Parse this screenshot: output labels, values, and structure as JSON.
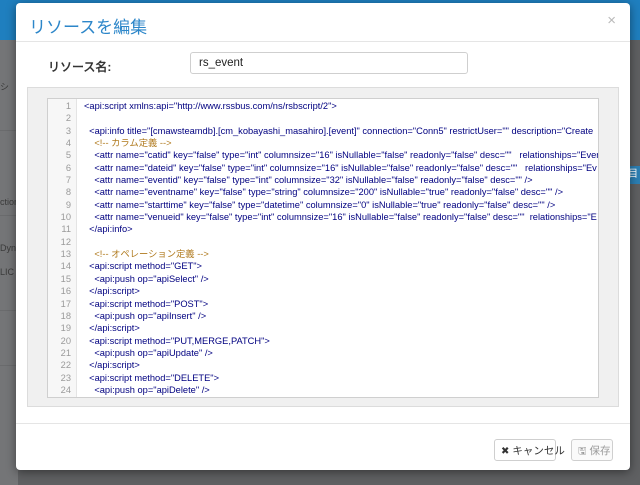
{
  "background": {
    "side_texts": [
      "シ",
      "ction",
      "Dyna",
      "LIC",
      "ル"
    ],
    "right_button": "目"
  },
  "modal": {
    "title": "リソースを編集",
    "close_icon": "×",
    "resource_name_label": "リソース名:",
    "resource_name_value": "rs_event"
  },
  "editor": {
    "lines": [
      {
        "n": "1",
        "text": "<api:script xmlns:api=\"http://www.rssbus.com/ns/rsbscript/2\">"
      },
      {
        "n": "2",
        "text": ""
      },
      {
        "n": "3",
        "text": "  <api:info title=\"[cmawsteamdb].[cm_kobayashi_masahiro].[event]\" connection=\"Conn5\" restrictUser=\"\" description=\"Create"
      },
      {
        "n": "4",
        "text": "    <!-- カラム定義 -->"
      },
      {
        "n": "5",
        "text": "    <attr name=\"catid\" key=\"false\" type=\"int\" columnsize=\"16\" isNullable=\"false\" readonly=\"false\" desc=\"\"   relationships=\"Even"
      },
      {
        "n": "6",
        "text": "    <attr name=\"dateid\" key=\"false\" type=\"int\" columnsize=\"16\" isNullable=\"false\" readonly=\"false\" desc=\"\"   relationships=\"Ev"
      },
      {
        "n": "7",
        "text": "    <attr name=\"eventid\" key=\"false\" type=\"int\" columnsize=\"32\" isNullable=\"false\" readonly=\"false\" desc=\"\" />"
      },
      {
        "n": "8",
        "text": "    <attr name=\"eventname\" key=\"false\" type=\"string\" columnsize=\"200\" isNullable=\"true\" readonly=\"false\" desc=\"\" />"
      },
      {
        "n": "9",
        "text": "    <attr name=\"starttime\" key=\"false\" type=\"datetime\" columnsize=\"0\" isNullable=\"true\" readonly=\"false\" desc=\"\" />"
      },
      {
        "n": "10",
        "text": "    <attr name=\"venueid\" key=\"false\" type=\"int\" columnsize=\"16\" isNullable=\"false\" readonly=\"false\" desc=\"\"  relationships=\"E"
      },
      {
        "n": "11",
        "text": "  </api:info>"
      },
      {
        "n": "12",
        "text": ""
      },
      {
        "n": "13",
        "text": "    <!-- オペレーション定義 -->"
      },
      {
        "n": "14",
        "text": "  <api:script method=\"GET\">"
      },
      {
        "n": "15",
        "text": "    <api:push op=\"apiSelect\" />"
      },
      {
        "n": "16",
        "text": "  </api:script>"
      },
      {
        "n": "17",
        "text": "  <api:script method=\"POST\">"
      },
      {
        "n": "18",
        "text": "    <api:push op=\"apiInsert\" />"
      },
      {
        "n": "19",
        "text": "  </api:script>"
      },
      {
        "n": "20",
        "text": "  <api:script method=\"PUT,MERGE,PATCH\">"
      },
      {
        "n": "21",
        "text": "    <api:push op=\"apiUpdate\" />"
      },
      {
        "n": "22",
        "text": "  </api:script>"
      },
      {
        "n": "23",
        "text": "  <api:script method=\"DELETE\">"
      },
      {
        "n": "24",
        "text": "    <api:push op=\"apiDelete\" />"
      }
    ]
  },
  "footer": {
    "cancel_icon": "✖",
    "cancel_label": "キャンセル",
    "save_icon": "🖫",
    "save_label": "保存"
  }
}
